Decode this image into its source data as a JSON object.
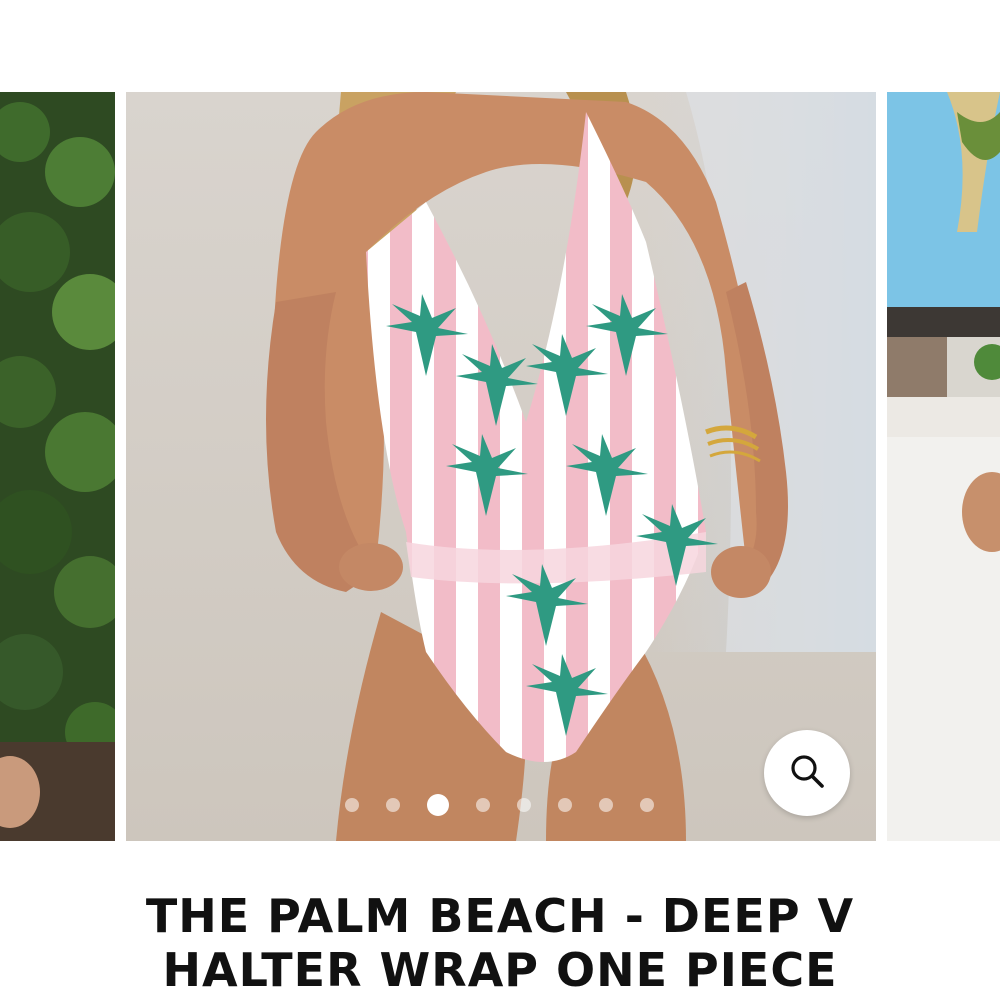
{
  "product": {
    "title_line1": "THE PALM BEACH - DEEP V",
    "title_line2": "HALTER WRAP ONE PIECE"
  },
  "gallery": {
    "slide_count": 8,
    "active_slide_index": 3,
    "zoom_icon": "magnifier-icon"
  },
  "colors": {
    "swimsuit_pink": "#f2bcc8",
    "palm_green": "#2f9a82",
    "sand": "#ddd7cf"
  }
}
